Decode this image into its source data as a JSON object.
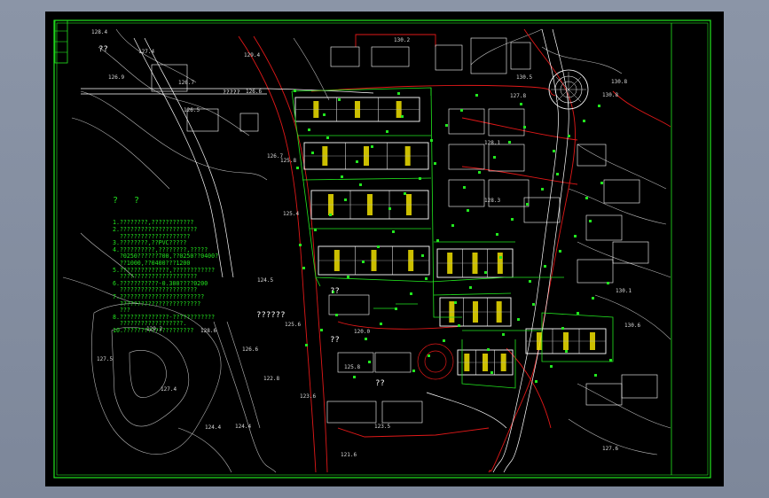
{
  "drawing": {
    "notes_title": "? ?",
    "notes": [
      "1.????????,????????????",
      "2.??????????????????????",
      "  ????????????????????",
      "3.????????,??PVC?????",
      "4.??????????,????????,?????",
      "  ?0250??????700,??0250??0400?",
      "  ??1000,??0400???1200",
      "5.??????????????,????????????",
      "  ??????????????????????",
      "6.???????????-0.300????0200",
      "  ??????????????????????",
      "7.????????????????????????",
      "  ???????????????????????",
      "  ???",
      "8.??????????????-????????????",
      "  ??????????????????.",
      "10.????????????????????"
    ],
    "spot_labels": [
      "??",
      "??",
      "??",
      "??????",
      "??",
      "?????"
    ],
    "elevations": [
      "128.4",
      "127.4",
      "126.9",
      "126.7",
      "129.4",
      "126.6",
      "126.5",
      "126.7",
      "130.2",
      "130.5",
      "130.8",
      "130.8",
      "127.8",
      "128.1",
      "125.8",
      "125.4",
      "124.5",
      "125.6",
      "129.2",
      "128.6",
      "127.5",
      "127.4",
      "126.6",
      "124.4",
      "124.4",
      "122.8",
      "123.6",
      "120.0",
      "125.8",
      "121.6",
      "123.5",
      "130.1",
      "130.6",
      "127.6",
      "128.3"
    ]
  },
  "colors": {
    "background": "#000000",
    "frame": "#22e61f",
    "notes": "#22e61f",
    "roads": "#ffffff",
    "contours": "#b9b9b9",
    "site_boundary": "#e01818",
    "buildings": "#ffffff",
    "pipes": "#22e61f"
  },
  "icons": {
    "roundabout": "circle-roundabout-icon",
    "title_block": "vertical-title-block-icon"
  }
}
